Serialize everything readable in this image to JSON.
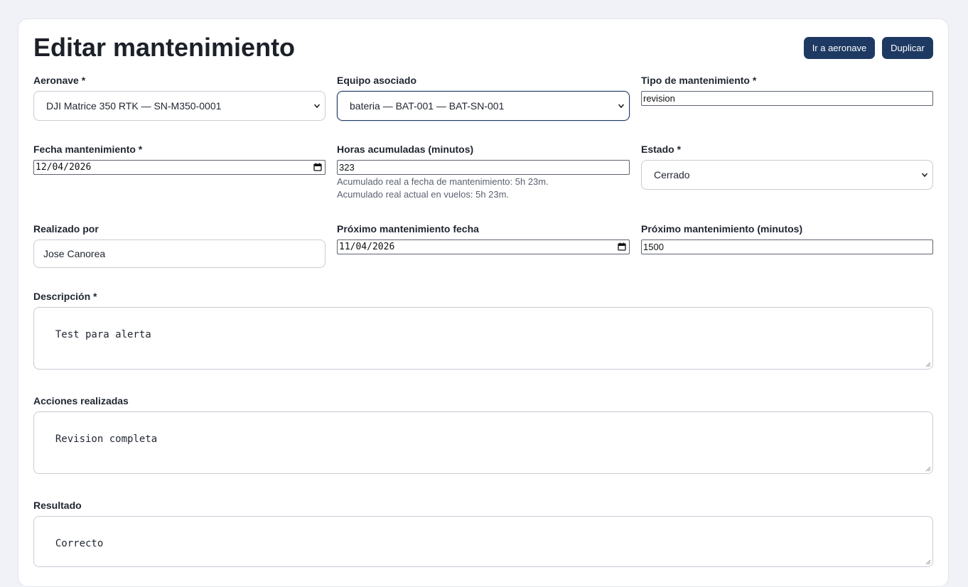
{
  "page": {
    "title": "Editar mantenimiento"
  },
  "actions": {
    "go_aircraft": "Ir a aeronave",
    "duplicate": "Duplicar"
  },
  "form": {
    "aeronave": {
      "label": "Aeronave *",
      "value": "DJI Matrice 350 RTK — SN-M350-0001"
    },
    "equipo": {
      "label": "Equipo asociado",
      "value": "bateria — BAT-001 — BAT-SN-001"
    },
    "tipo": {
      "label": "Tipo de mantenimiento *",
      "value": "revision"
    },
    "fecha": {
      "label": "Fecha mantenimiento *",
      "value": "12/04/2026"
    },
    "horas": {
      "label": "Horas acumuladas (minutos)",
      "value": "323",
      "help1": "Acumulado real a fecha de mantenimiento: 5h 23m.",
      "help2": "Acumulado real actual en vuelos: 5h 23m."
    },
    "estado": {
      "label": "Estado *",
      "value": "Cerrado"
    },
    "realizado": {
      "label": "Realizado por",
      "value": "Jose Canorea"
    },
    "proxima_fecha": {
      "label": "Próximo mantenimiento fecha",
      "value": "11/04/2026"
    },
    "proximo_minutos": {
      "label": "Próximo mantenimiento (minutos)",
      "value": "1500"
    },
    "descripcion": {
      "label": "Descripción *",
      "value": "Test para alerta"
    },
    "acciones": {
      "label": "Acciones realizadas",
      "value": "Revision completa"
    },
    "resultado": {
      "label": "Resultado",
      "value": "Correcto"
    }
  },
  "colors": {
    "accent": "#1e3a63",
    "background": "#f1f2f7",
    "card": "#ffffff"
  },
  "icons": {
    "select": "chevron-down-icon",
    "date": "calendar-icon",
    "resize": "resize-grip-icon"
  }
}
